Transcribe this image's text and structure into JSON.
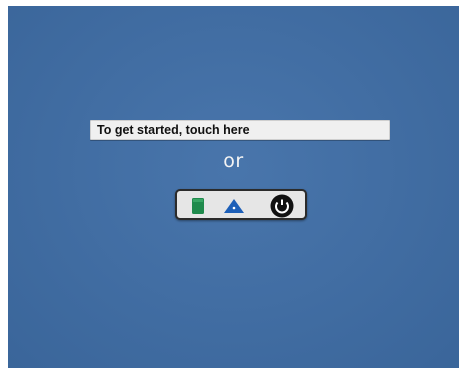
{
  "prompt": {
    "label": "To get started, touch here"
  },
  "separator": {
    "text": "or"
  },
  "buttons": [
    {
      "name": "green-button",
      "icon": "green-square-icon",
      "color": "#1f8a4c"
    },
    {
      "name": "blue-button",
      "icon": "blue-triangle-icon",
      "color": "#1d5fb8"
    },
    {
      "name": "power-button",
      "icon": "power-circle-icon",
      "color": "#111111"
    }
  ],
  "colors": {
    "background": "#3f6ea7",
    "bar": "#f0f0f0",
    "panel": "#e6e6e6"
  }
}
